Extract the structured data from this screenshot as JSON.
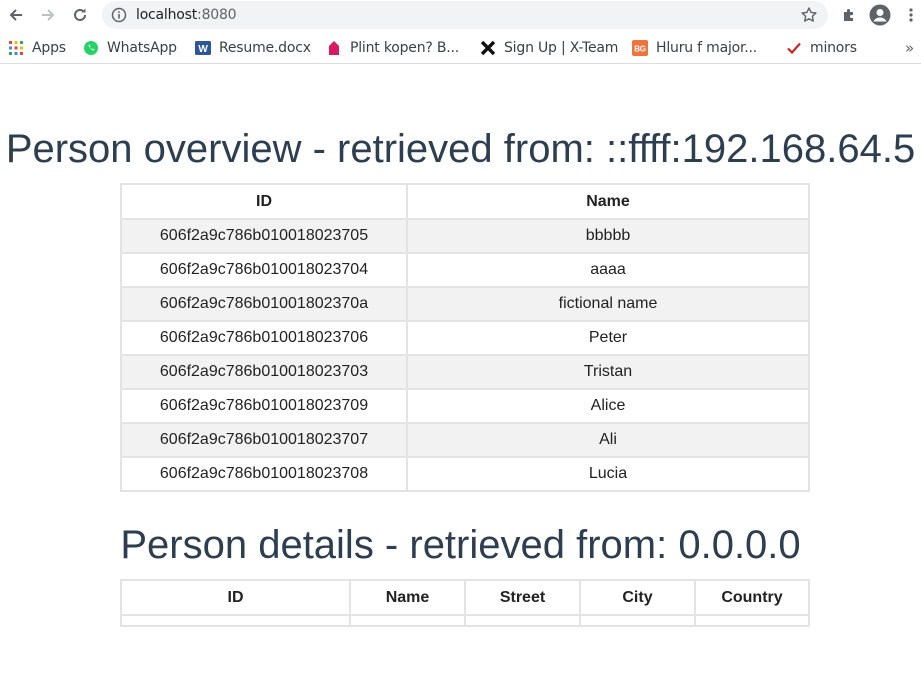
{
  "browser": {
    "url_host": "localhost",
    "url_port": ":8080",
    "bookmarks": [
      {
        "label": "Apps",
        "icon": "apps-grid-icon"
      },
      {
        "label": "WhatsApp",
        "icon": "whatsapp-icon"
      },
      {
        "label": "Resume.docx",
        "icon": "word-doc-icon"
      },
      {
        "label": "Plint kopen? B...",
        "icon": "plint-icon"
      },
      {
        "label": "Sign Up | X-Team",
        "icon": "x-team-icon"
      },
      {
        "label": "Hluru f major...",
        "icon": "bg-icon"
      },
      {
        "label": "minors",
        "icon": "checkmark-icon"
      }
    ],
    "overflow": "»"
  },
  "overview": {
    "title": "Person overview - retrieved from: ::ffff:192.168.64.5",
    "columns": [
      "ID",
      "Name"
    ],
    "rows": [
      [
        "606f2a9c786b010018023705",
        "bbbbb"
      ],
      [
        "606f2a9c786b010018023704",
        "aaaa"
      ],
      [
        "606f2a9c786b01001802370a",
        "fictional name"
      ],
      [
        "606f2a9c786b010018023706",
        "Peter"
      ],
      [
        "606f2a9c786b010018023703",
        "Tristan"
      ],
      [
        "606f2a9c786b010018023709",
        "Alice"
      ],
      [
        "606f2a9c786b010018023707",
        "Ali"
      ],
      [
        "606f2a9c786b010018023708",
        "Lucia"
      ]
    ]
  },
  "details": {
    "title": "Person details - retrieved from: 0.0.0.0",
    "columns": [
      "ID",
      "Name",
      "Street",
      "City",
      "Country"
    ],
    "rows": [
      [
        "",
        "",
        "",
        "",
        ""
      ]
    ]
  }
}
